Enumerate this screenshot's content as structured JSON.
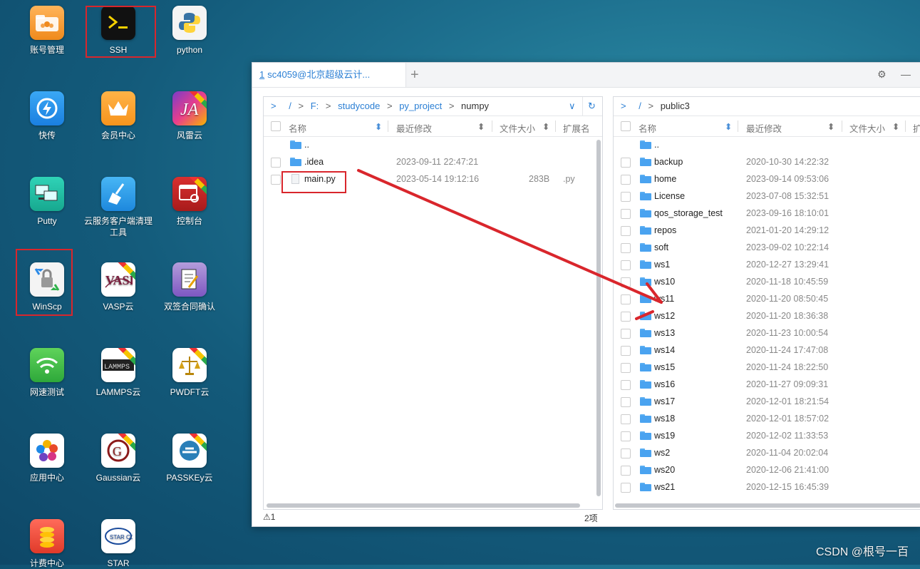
{
  "desktop_icons": [
    {
      "label": "账号管理",
      "icon": "folder-users-icon"
    },
    {
      "label": "SSH",
      "icon": "terminal-icon"
    },
    {
      "label": "python",
      "icon": "python-icon"
    },
    {
      "label": "快传",
      "icon": "quick-transfer-icon"
    },
    {
      "label": "会员中心",
      "icon": "crown-icon"
    },
    {
      "label": "风雷云",
      "icon": "fenglei-icon"
    },
    {
      "label": "Putty",
      "icon": "putty-icon"
    },
    {
      "label": "云服务客户端清理工具",
      "icon": "cleanup-broom-icon"
    },
    {
      "label": "控制台",
      "icon": "console-gear-icon"
    },
    {
      "label": "WinScp",
      "icon": "winscp-icon"
    },
    {
      "label": "VASP云",
      "icon": "vasp-icon"
    },
    {
      "label": "双签合同确认",
      "icon": "contract-icon"
    },
    {
      "label": "网速测试",
      "icon": "wifi-icon"
    },
    {
      "label": "LAMMPS云",
      "icon": "lammps-icon"
    },
    {
      "label": "PWDFT云",
      "icon": "pwdft-icon"
    },
    {
      "label": "应用中心",
      "icon": "app-center-icon"
    },
    {
      "label": "Gaussian云",
      "icon": "gaussian-icon"
    },
    {
      "label": "PASSKEy云",
      "icon": "passkey-icon"
    },
    {
      "label": "计费中心",
      "icon": "billing-coins-icon"
    },
    {
      "label": "STAR",
      "icon": "starccm-icon"
    }
  ],
  "window": {
    "tab_number": "1",
    "tab_title": "sc4059@北京超级云计...",
    "add_tab": "+",
    "settings_icon": "⚙",
    "minimize_icon": "—"
  },
  "left_pane": {
    "path": [
      "/",
      "F:",
      "studycode",
      "py_project",
      "numpy"
    ],
    "columns": {
      "name": "名称",
      "modified": "最近修改",
      "size": "文件大小",
      "ext": "扩展名"
    },
    "rows": [
      {
        "type": "folder",
        "name": "..",
        "modified": "",
        "size": "",
        "ext": ""
      },
      {
        "type": "folder",
        "name": ".idea",
        "modified": "2023-09-11 22:47:21",
        "size": "",
        "ext": ""
      },
      {
        "type": "file",
        "name": "main.py",
        "modified": "2023-05-14 19:12:16",
        "size": "283B",
        "ext": ".py"
      }
    ],
    "status_left": "⚠1",
    "status_right": "2项"
  },
  "right_pane": {
    "path": [
      "/",
      "public3"
    ],
    "columns": {
      "name": "名称",
      "modified": "最近修改",
      "size": "文件大小",
      "ext": "扩"
    },
    "rows": [
      {
        "name": "..",
        "modified": ""
      },
      {
        "name": "backup",
        "modified": "2020-10-30 14:22:32"
      },
      {
        "name": "home",
        "modified": "2023-09-14 09:53:06"
      },
      {
        "name": "License",
        "modified": "2023-07-08 15:32:51"
      },
      {
        "name": "qos_storage_test",
        "modified": "2023-09-16 18:10:01"
      },
      {
        "name": "repos",
        "modified": "2021-01-20 14:29:12"
      },
      {
        "name": "soft",
        "modified": "2023-09-02 10:22:14"
      },
      {
        "name": "ws1",
        "modified": "2020-12-27 13:29:41"
      },
      {
        "name": "ws10",
        "modified": "2020-11-18 10:45:59"
      },
      {
        "name": "ws11",
        "modified": "2020-11-20 08:50:45"
      },
      {
        "name": "ws12",
        "modified": "2020-11-20 18:36:38"
      },
      {
        "name": "ws13",
        "modified": "2020-11-23 10:00:54"
      },
      {
        "name": "ws14",
        "modified": "2020-11-24 17:47:08"
      },
      {
        "name": "ws15",
        "modified": "2020-11-24 18:22:50"
      },
      {
        "name": "ws16",
        "modified": "2020-11-27 09:09:31"
      },
      {
        "name": "ws17",
        "modified": "2020-12-01 18:21:54"
      },
      {
        "name": "ws18",
        "modified": "2020-12-01 18:57:02"
      },
      {
        "name": "ws19",
        "modified": "2020-12-02 11:33:53"
      },
      {
        "name": "ws2",
        "modified": "2020-11-04 20:02:04"
      },
      {
        "name": "ws20",
        "modified": "2020-12-06 21:41:00"
      },
      {
        "name": "ws21",
        "modified": "2020-12-15 16:45:39"
      }
    ]
  },
  "watermark": "CSDN @根号一百",
  "colors": {
    "accent": "#2b7fd4",
    "annotation_red": "#d9262c",
    "folder": "#4aa3f0"
  }
}
